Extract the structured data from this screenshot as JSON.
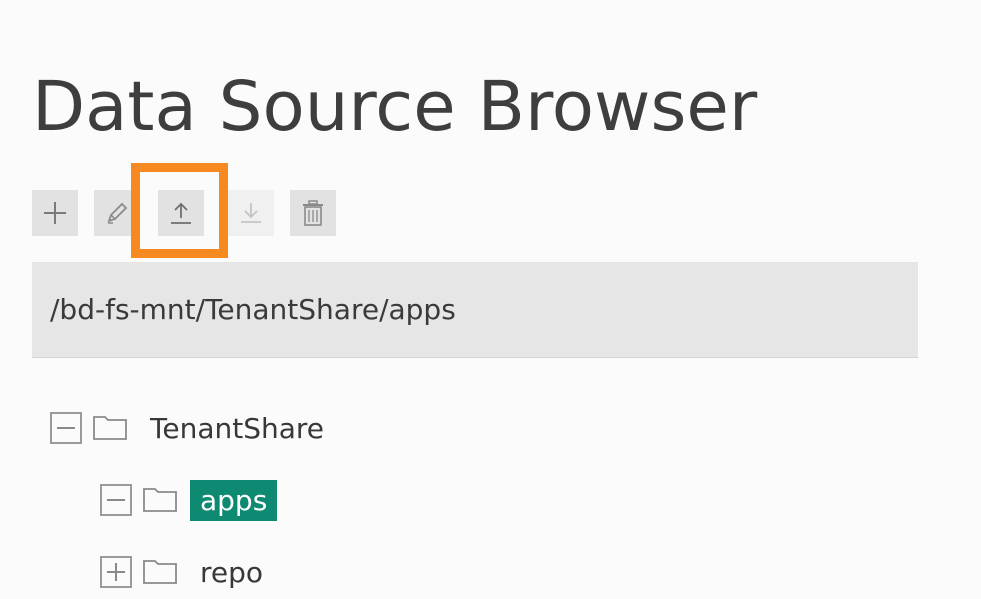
{
  "page": {
    "title": "Data Source Browser"
  },
  "toolbar": {
    "buttons": [
      {
        "name": "add",
        "icon": "plus-icon",
        "enabled": true
      },
      {
        "name": "edit",
        "icon": "pencil-icon",
        "enabled": true
      },
      {
        "name": "upload",
        "icon": "upload-icon",
        "enabled": true,
        "highlighted": true
      },
      {
        "name": "download",
        "icon": "download-icon",
        "enabled": false
      },
      {
        "name": "delete",
        "icon": "trash-icon",
        "enabled": true
      }
    ],
    "highlight_color": "#f6891f"
  },
  "path_bar": {
    "value": "/bd-fs-mnt/TenantShare/apps"
  },
  "tree": {
    "nodes": [
      {
        "label": "TenantShare",
        "expanded": true,
        "selected": false,
        "icon": "folder-icon"
      },
      {
        "label": "apps",
        "expanded": true,
        "selected": true,
        "icon": "folder-icon"
      },
      {
        "label": "repo",
        "expanded": false,
        "selected": false,
        "icon": "folder-icon"
      }
    ],
    "selected_color": "#0e8a72"
  }
}
